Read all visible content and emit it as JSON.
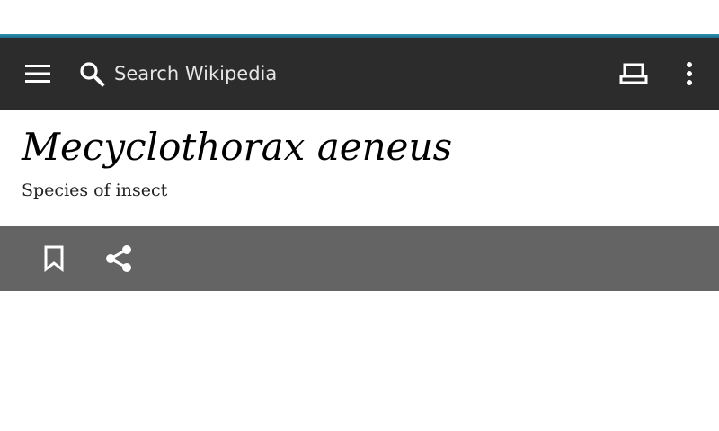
{
  "toolbar": {
    "search_placeholder": "Search Wikipedia",
    "icons": {
      "menu": "hamburger-menu-icon",
      "search": "search-icon",
      "reading_list": "reading-list-icon",
      "overflow": "overflow-menu-icon"
    },
    "background_color": "#2c2c2c",
    "accent_color": "#2f8fb1"
  },
  "article": {
    "title": "Mecyclothorax aeneus",
    "description": "Species of insect"
  },
  "action_bar": {
    "icons": {
      "save": "bookmark-icon",
      "share": "share-icon"
    },
    "background_color": "#646464"
  }
}
